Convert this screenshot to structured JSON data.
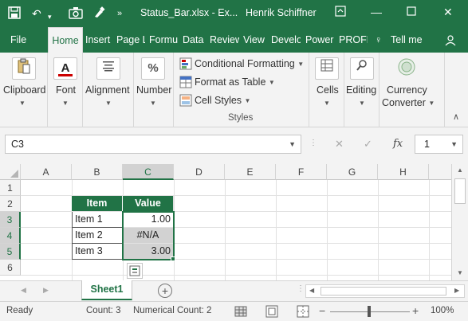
{
  "titlebar": {
    "filename": "Status_Bar.xlsx - Ex...",
    "user": "Henrik Schiffner"
  },
  "tabs": [
    "File",
    "Home",
    "Insert",
    "Page L",
    "Formu",
    "Data",
    "Review",
    "View",
    "Develo",
    "Power",
    "PROFE"
  ],
  "tell_me": "Tell me",
  "ribbon": {
    "clipboard": "Clipboard",
    "font": "Font",
    "alignment": "Alignment",
    "number": "Number",
    "conditional_formatting": "Conditional Formatting",
    "format_as_table": "Format as Table",
    "cell_styles": "Cell Styles",
    "styles_group": "Styles",
    "cells": "Cells",
    "editing": "Editing",
    "currency_converter_1": "Currency",
    "currency_converter_2": "Converter"
  },
  "formula_bar": {
    "name_box": "C3",
    "fx": "fx",
    "value": "1"
  },
  "grid": {
    "columns": [
      "A",
      "B",
      "C",
      "D",
      "E",
      "F",
      "G",
      "H"
    ],
    "rows": [
      "1",
      "2",
      "3",
      "4",
      "5",
      "6"
    ],
    "header_item": "Item",
    "header_value": "Value",
    "items": [
      {
        "name": "Item 1",
        "value": "1.00"
      },
      {
        "name": "Item 2",
        "value": "#N/A"
      },
      {
        "name": "Item 3",
        "value": "3.00"
      }
    ]
  },
  "sheet_tab": "Sheet1",
  "status": {
    "ready": "Ready",
    "count": "Count: 3",
    "numerical_count": "Numerical Count: 2",
    "zoom": "100%"
  },
  "colors": {
    "accent": "#217346",
    "header_fill": "#217346",
    "selected_fill": "#d2d2d2"
  }
}
